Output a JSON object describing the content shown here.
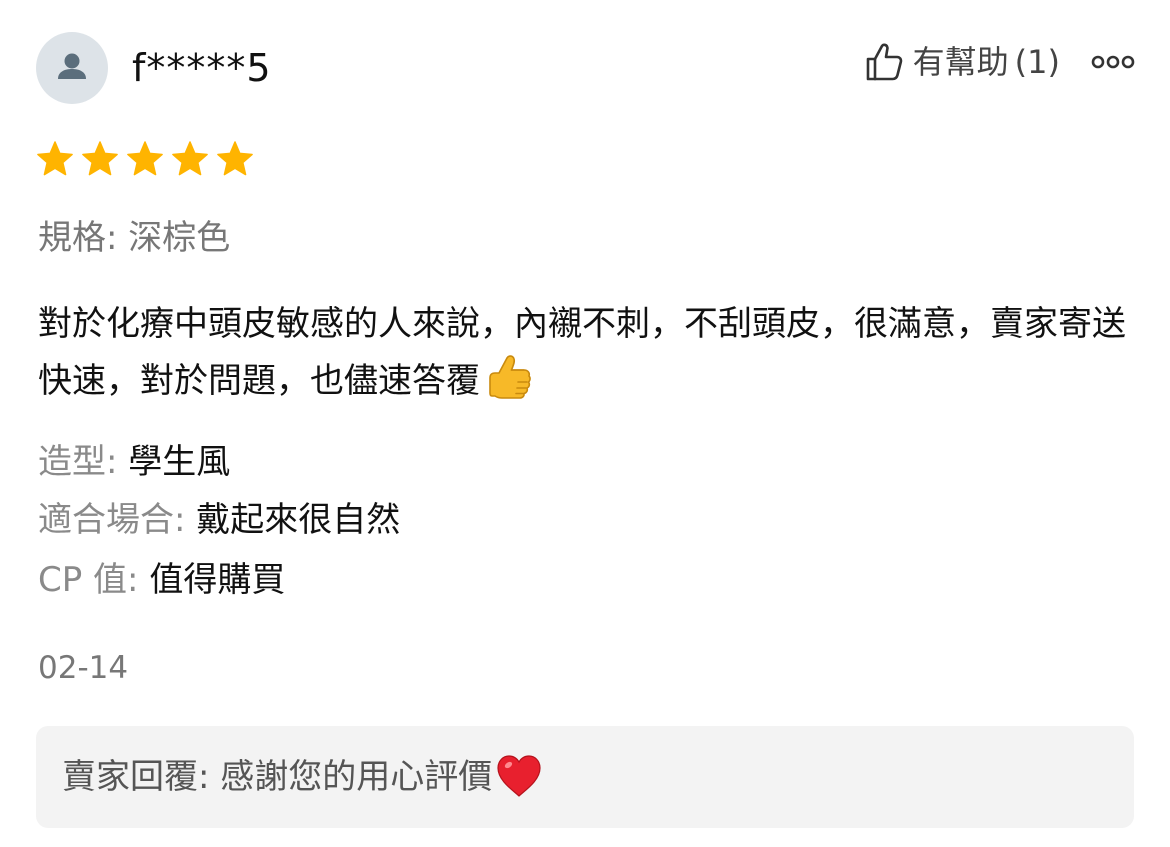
{
  "review": {
    "username": "f*****5",
    "helpful_label": "有幫助",
    "helpful_count": "(1)",
    "rating": 5,
    "rating_max": 5,
    "spec": "規格: 深棕色",
    "body": "對於化療中頭皮敏感的人來說，內襯不刺，不刮頭皮，很滿意，賣家寄送快速，對於問題，也儘速答覆",
    "attributes": [
      {
        "label": "造型: ",
        "value": "學生風"
      },
      {
        "label": "適合場合: ",
        "value": "戴起來很自然"
      },
      {
        "label": "CP 值: ",
        "value": "值得購買"
      }
    ],
    "date": "02-14",
    "seller_reply": {
      "label": "賣家回覆: ",
      "text": "感謝您的用心評價"
    }
  },
  "icons": {
    "avatar": "person-icon",
    "helpful": "thumbs-up-outline-icon",
    "more": "more-options-icon",
    "star": "star-icon",
    "body_emoji": "thumbs-up-emoji",
    "reply_emoji": "red-heart-emoji"
  },
  "colors": {
    "star": "#FFB400",
    "avatar_bg": "#DDE3E8",
    "avatar_fg": "#5B6E7C",
    "reply_bg": "#F3F3F3",
    "muted_text": "#8A8A8A",
    "heart": "#E8202E",
    "thumb_emoji": "#F7B928"
  }
}
